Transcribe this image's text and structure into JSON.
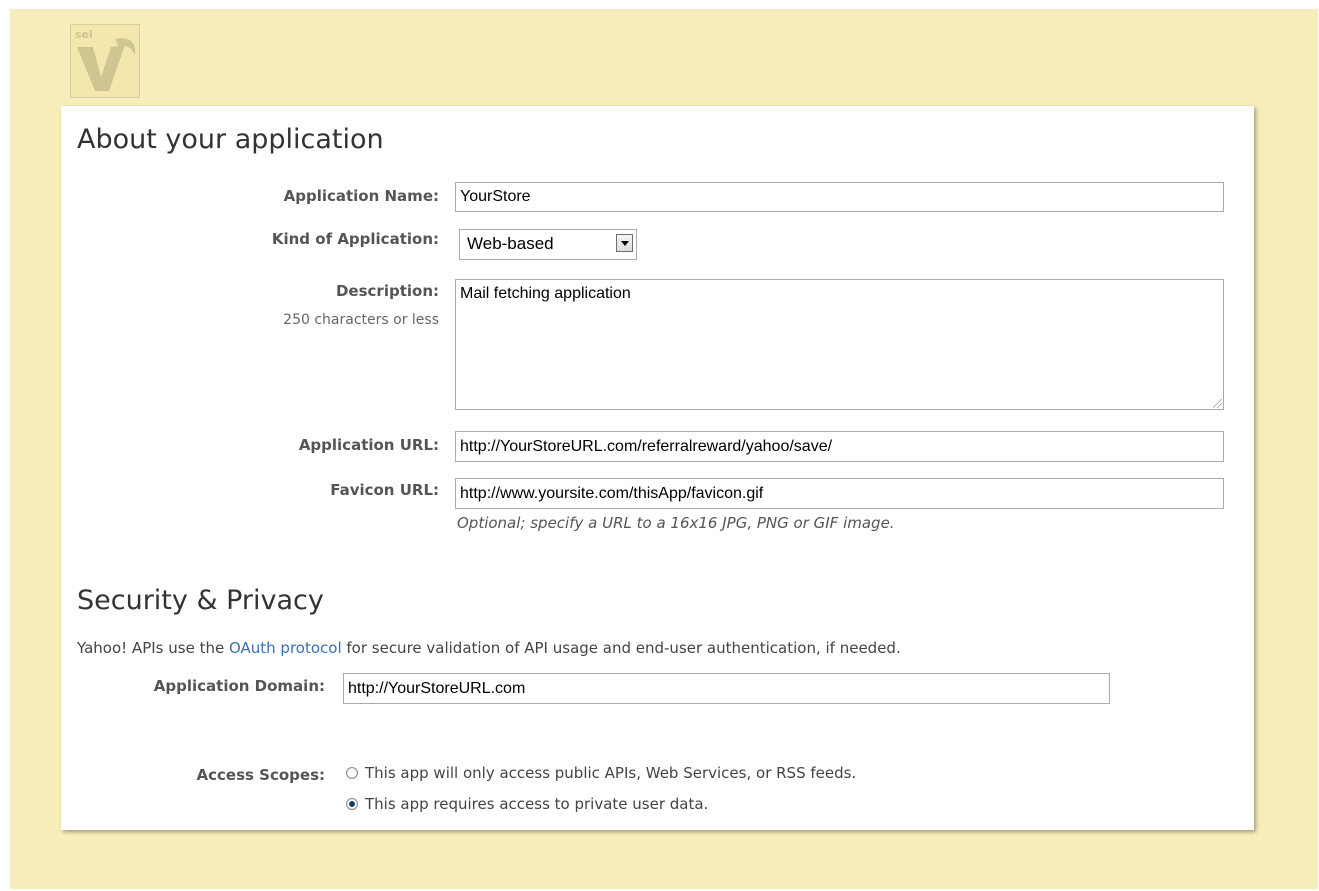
{
  "about": {
    "heading": "About your application",
    "app_name": {
      "label": "Application Name:",
      "value": "YourStore"
    },
    "kind": {
      "label": "Kind of Application:",
      "selected": "Web-based"
    },
    "description": {
      "label": "Description:",
      "sublabel": "250 characters or less",
      "value": "Mail fetching application"
    },
    "app_url": {
      "label": "Application URL:",
      "value": "http://YourStoreURL.com/referralreward/yahoo/save/"
    },
    "favicon_url": {
      "label": "Favicon URL:",
      "value": "http://www.yoursite.com/thisApp/favicon.gif",
      "hint": "Optional; specify a URL to a 16x16 JPG, PNG or GIF image."
    }
  },
  "security": {
    "heading": "Security & Privacy",
    "intro_before": "Yahoo! APIs use the ",
    "intro_link": "OAuth protocol",
    "intro_after": " for secure validation of API usage and end-user authentication, if needed.",
    "domain": {
      "label": "Application Domain:",
      "value": "http://YourStoreURL.com"
    },
    "scopes": {
      "label": "Access Scopes:",
      "options": [
        {
          "label": "This app will only access public APIs, Web Services, or RSS feeds.",
          "checked": false
        },
        {
          "label": "This app requires access to private user data.",
          "checked": true
        }
      ]
    }
  },
  "colors": {
    "page_bg": "#f8eebb",
    "link": "#3b6fb5"
  }
}
